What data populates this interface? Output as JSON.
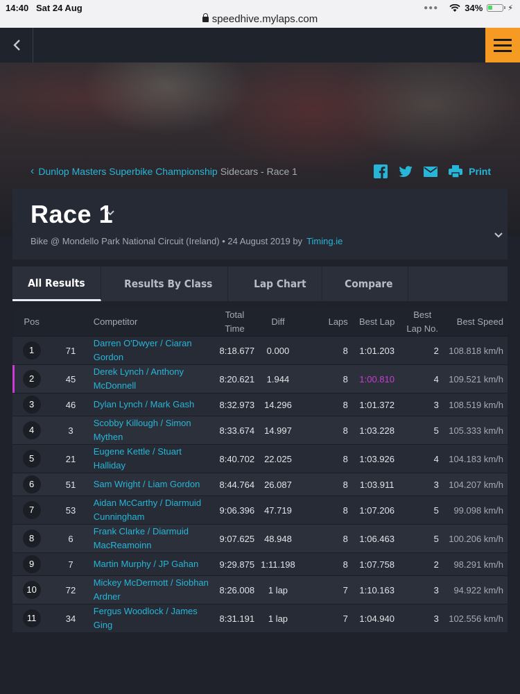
{
  "status_bar": {
    "time": "14:40",
    "date": "Sat 24 Aug",
    "url": "speedhive.mylaps.com",
    "battery": "34%"
  },
  "breadcrumb": {
    "parent": "Dunlop Masters Superbike Championship",
    "current": "Sidecars - Race 1"
  },
  "share": {
    "print_label": "Print"
  },
  "race": {
    "title": "Race 1",
    "subtitle": "Bike @ Mondello Park National Circuit (Ireland) • 24 August 2019 by",
    "organizer": "Timing.ie"
  },
  "tabs": [
    "All Results",
    "Results By Class",
    "Lap Chart",
    "Compare"
  ],
  "columns": {
    "pos": "Pos",
    "competitor": "Competitor",
    "total_time": "Total Time",
    "diff": "Diff",
    "laps": "Laps",
    "best_lap": "Best Lap",
    "best_lap_no": "Best Lap No.",
    "best_speed": "Best Speed"
  },
  "colors": {
    "accent": "#27b6d8",
    "menu": "#f59a23",
    "fastest": "#c93dd6"
  },
  "rows": [
    {
      "pos": "1",
      "num": "71",
      "name1": "Darren O'Dwyer / Ciaran",
      "name2": "Gordon",
      "time": "8:18.677",
      "diff": "0.000",
      "laps": "8",
      "best": "1:01.203",
      "best_no": "2",
      "speed": "108.818 km/h"
    },
    {
      "pos": "2",
      "num": "45",
      "name1": "Derek Lynch / Anthony",
      "name2": "McDonnell",
      "time": "8:20.621",
      "diff": "1.944",
      "laps": "8",
      "best": "1:00.810",
      "best_no": "4",
      "speed": "109.521 km/h"
    },
    {
      "pos": "3",
      "num": "46",
      "name1": "Dylan Lynch / Mark Gash",
      "name2": "",
      "time": "8:32.973",
      "diff": "14.296",
      "laps": "8",
      "best": "1:01.372",
      "best_no": "3",
      "speed": "108.519 km/h"
    },
    {
      "pos": "4",
      "num": "3",
      "name1": "Scobby Killough / Simon",
      "name2": "Mythen",
      "time": "8:33.674",
      "diff": "14.997",
      "laps": "8",
      "best": "1:03.228",
      "best_no": "5",
      "speed": "105.333 km/h"
    },
    {
      "pos": "5",
      "num": "21",
      "name1": "Eugene Kettle / Stuart",
      "name2": "Halliday",
      "time": "8:40.702",
      "diff": "22.025",
      "laps": "8",
      "best": "1:03.926",
      "best_no": "4",
      "speed": "104.183 km/h"
    },
    {
      "pos": "6",
      "num": "51",
      "name1": "Sam Wright / Liam Gordon",
      "name2": "",
      "time": "8:44.764",
      "diff": "26.087",
      "laps": "8",
      "best": "1:03.911",
      "best_no": "3",
      "speed": "104.207 km/h"
    },
    {
      "pos": "7",
      "num": "53",
      "name1": "Aidan McCarthy / Diarmuid",
      "name2": "Cunningham",
      "time": "9:06.396",
      "diff": "47.719",
      "laps": "8",
      "best": "1:07.206",
      "best_no": "5",
      "speed": "99.098 km/h"
    },
    {
      "pos": "8",
      "num": "6",
      "name1": "Frank Clarke / Diarmuid",
      "name2": "MacReamoinn",
      "time": "9:07.625",
      "diff": "48.948",
      "laps": "8",
      "best": "1:06.463",
      "best_no": "5",
      "speed": "100.206 km/h"
    },
    {
      "pos": "9",
      "num": "7",
      "name1": "Martin Murphy / JP Gahan",
      "name2": "",
      "time": "9:29.875",
      "diff": "1:11.198",
      "laps": "8",
      "best": "1:07.758",
      "best_no": "2",
      "speed": "98.291 km/h"
    },
    {
      "pos": "10",
      "num": "72",
      "name1": "Mickey McDermott / Siobhan",
      "name2": "Ardner",
      "time": "8:26.008",
      "diff": "1 lap",
      "laps": "7",
      "best": "1:10.163",
      "best_no": "3",
      "speed": "94.922 km/h"
    },
    {
      "pos": "11",
      "num": "34",
      "name1": "Fergus Woodlock / James",
      "name2": "Ging",
      "time": "8:31.191",
      "diff": "1 lap",
      "laps": "7",
      "best": "1:04.940",
      "best_no": "3",
      "speed": "102.556 km/h"
    }
  ]
}
